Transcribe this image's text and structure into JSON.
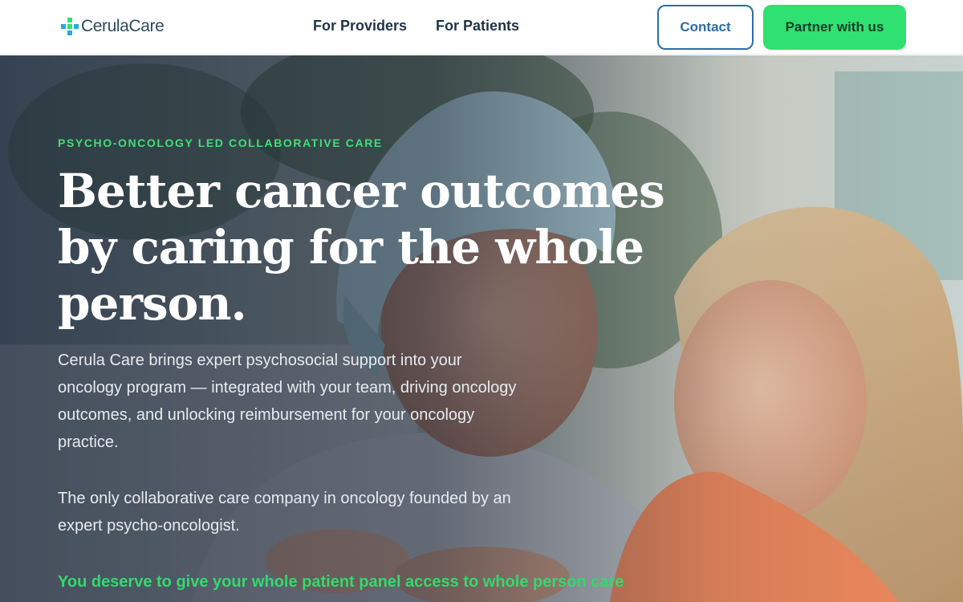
{
  "header": {
    "logo_text": "CerulaCare",
    "nav": [
      {
        "label": "For Providers"
      },
      {
        "label": "For Patients"
      }
    ],
    "contact_label": "Contact",
    "partner_label": "Partner with us"
  },
  "hero": {
    "eyebrow": "PSYCHO-ONCOLOGY LED COLLABORATIVE CARE",
    "headline": "Better cancer outcomes by caring for the whole person.",
    "paragraph_1": "Cerula Care brings expert psychosocial support into your oncology program — integrated with your team, driving oncology outcomes, and unlocking reimbursement for your oncology practice.",
    "paragraph_2": "The only collaborative care company in oncology founded by an expert psycho-oncologist.",
    "cta_line": "You deserve to give your whole patient panel access to whole person care"
  },
  "colors": {
    "accent_green": "#2ee170",
    "brand_blue": "#2c6ea6",
    "navy": "#1f3347"
  }
}
